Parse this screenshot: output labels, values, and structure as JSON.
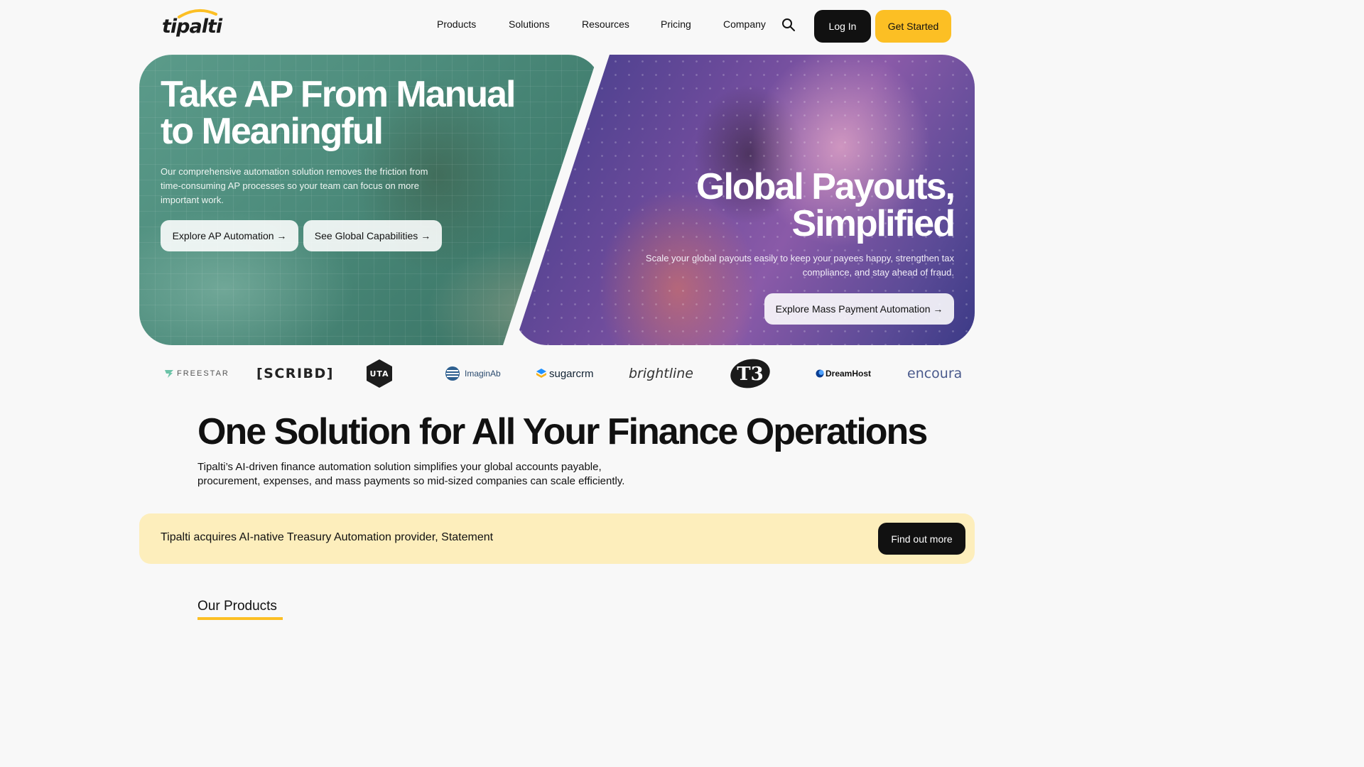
{
  "brand": {
    "logo_text": "tipalti",
    "accent_color": "#fcbf24"
  },
  "nav": {
    "links": [
      "Products",
      "Solutions",
      "Resources",
      "Pricing",
      "Company"
    ],
    "search_icon": "search-icon",
    "login_label": "Log In",
    "get_started_label": "Get Started"
  },
  "hero_left": {
    "title_line1": "Take AP From Manual",
    "title_line2": "to Meaningful",
    "subtitle": "Our comprehensive automation solution removes the friction from time-consuming AP processes so your team can focus on more important work.",
    "button_ap": "Explore AP Automation →",
    "button_global": "See Global Capabilities →"
  },
  "hero_right": {
    "title_line1": "Global Payouts,",
    "title_line2": "Simplified",
    "subtitle": "Scale your global payouts easily to keep your payees happy, strengthen tax compliance, and stay ahead of fraud.",
    "button_mass": "Explore Mass Payment Automation →"
  },
  "customer_logos": {
    "freestar": "FREESTAR",
    "scribd": "[SCRIBD]",
    "uta": "UTA",
    "imaginab": "ImaginAb",
    "sugarcrm": "sugarcrm",
    "brightline": "brightline",
    "t3": "T3",
    "dreamhost": "DreamHost",
    "encoura": "encoura"
  },
  "main": {
    "title": "One Solution for All Your Finance Operations",
    "description": "Tipalti’s AI-driven finance automation solution simplifies your global accounts payable, procurement, expenses, and mass payments so mid-sized companies can scale efficiently."
  },
  "banner": {
    "text": "Tipalti acquires AI-native Treasury Automation provider, Statement",
    "button": "Find out more",
    "background": "#fdeebc"
  },
  "products_section": {
    "heading": "Our Products"
  }
}
